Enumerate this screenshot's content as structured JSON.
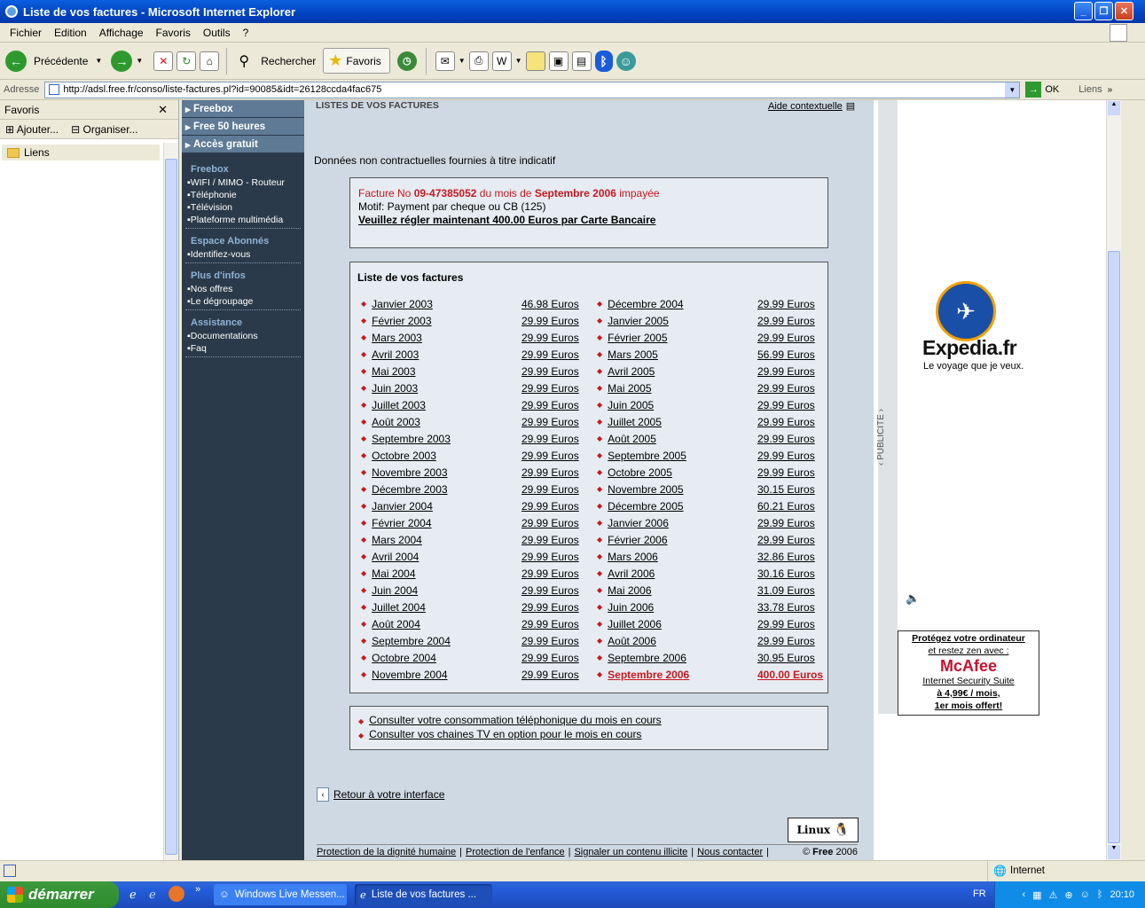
{
  "window": {
    "title": "Liste de vos factures - Microsoft Internet Explorer"
  },
  "menu": [
    "Fichier",
    "Edition",
    "Affichage",
    "Favoris",
    "Outils",
    "?"
  ],
  "toolbar": {
    "back_label": "Précédente",
    "search_label": "Rechercher",
    "favorites_label": "Favoris"
  },
  "address": {
    "label": "Adresse",
    "url": "http://adsl.free.fr/conso/liste-factures.pl?id=90085&idt=26128ccda4fac675",
    "go_label": "OK",
    "links_label": "Liens"
  },
  "favpanel": {
    "title": "Favoris",
    "add_label": "Ajouter...",
    "organize_label": "Organiser...",
    "folder": "Liens"
  },
  "leftnav": {
    "tabs": [
      "Freebox",
      "Free 50 heures",
      "Accès gratuit"
    ],
    "sections": [
      {
        "title": "Freebox",
        "items": [
          "WIFI / MIMO - Routeur",
          "Téléphonie",
          "Télévision",
          "Plateforme multimédia"
        ]
      },
      {
        "title": "Espace Abonnés",
        "items": [
          "Identifiez-vous"
        ]
      },
      {
        "title": "Plus d'infos",
        "items": [
          "Nos offres",
          "Le dégroupage"
        ]
      },
      {
        "title": "Assistance",
        "items": [
          "Documentations",
          "Faq"
        ]
      }
    ]
  },
  "main": {
    "header_title": "LISTES DE VOS FACTURES",
    "help_label": "Aide contextuelle",
    "disclaimer": "Données non contractuelles fournies à titre indicatif",
    "alert": {
      "prefix": "Facture No ",
      "number": "09-47385052",
      "mid": " du mois de ",
      "month": "Septembre 2006",
      "suffix": " impayée",
      "motif": "Motif: Payment par cheque ou CB (125)",
      "cta": "Veuillez régler maintenant 400.00 Euros par Carte Bancaire"
    },
    "list_title": "Liste de vos factures",
    "invoices_left": [
      [
        "Janvier 2003",
        "46.98 Euros"
      ],
      [
        "Février 2003",
        "29.99 Euros"
      ],
      [
        "Mars 2003",
        "29.99 Euros"
      ],
      [
        "Avril 2003",
        "29.99 Euros"
      ],
      [
        "Mai 2003",
        "29.99 Euros"
      ],
      [
        "Juin 2003",
        "29.99 Euros"
      ],
      [
        "Juillet 2003",
        "29.99 Euros"
      ],
      [
        "Août 2003",
        "29.99 Euros"
      ],
      [
        "Septembre 2003",
        "29.99 Euros"
      ],
      [
        "Octobre 2003",
        "29.99 Euros"
      ],
      [
        "Novembre 2003",
        "29.99 Euros"
      ],
      [
        "Décembre 2003",
        "29.99 Euros"
      ],
      [
        "Janvier 2004",
        "29.99 Euros"
      ],
      [
        "Février 2004",
        "29.99 Euros"
      ],
      [
        "Mars 2004",
        "29.99 Euros"
      ],
      [
        "Avril 2004",
        "29.99 Euros"
      ],
      [
        "Mai 2004",
        "29.99 Euros"
      ],
      [
        "Juin 2004",
        "29.99 Euros"
      ],
      [
        "Juillet 2004",
        "29.99 Euros"
      ],
      [
        "Août 2004",
        "29.99 Euros"
      ],
      [
        "Septembre 2004",
        "29.99 Euros"
      ],
      [
        "Octobre 2004",
        "29.99 Euros"
      ],
      [
        "Novembre 2004",
        "29.99 Euros"
      ]
    ],
    "invoices_right": [
      [
        "Décembre 2004",
        "29.99 Euros"
      ],
      [
        "Janvier 2005",
        "29.99 Euros"
      ],
      [
        "Février 2005",
        "29.99 Euros"
      ],
      [
        "Mars 2005",
        "56.99 Euros"
      ],
      [
        "Avril 2005",
        "29.99 Euros"
      ],
      [
        "Mai 2005",
        "29.99 Euros"
      ],
      [
        "Juin 2005",
        "29.99 Euros"
      ],
      [
        "Juillet 2005",
        "29.99 Euros"
      ],
      [
        "Août 2005",
        "29.99 Euros"
      ],
      [
        "Septembre 2005",
        "29.99 Euros"
      ],
      [
        "Octobre 2005",
        "29.99 Euros"
      ],
      [
        "Novembre 2005",
        "30.15 Euros"
      ],
      [
        "Décembre 2005",
        "60.21 Euros"
      ],
      [
        "Janvier 2006",
        "29.99 Euros"
      ],
      [
        "Février 2006",
        "29.99 Euros"
      ],
      [
        "Mars 2006",
        "32.86 Euros"
      ],
      [
        "Avril 2006",
        "30.16 Euros"
      ],
      [
        "Mai 2006",
        "31.09 Euros"
      ],
      [
        "Juin 2006",
        "33.78 Euros"
      ],
      [
        "Juillet 2006",
        "29.99 Euros"
      ],
      [
        "Août 2006",
        "29.99 Euros"
      ],
      [
        "Septembre 2006",
        "30.95 Euros"
      ],
      [
        "Septembre 2006",
        "400.00 Euros"
      ]
    ],
    "extra_links": [
      "Consulter votre consommation téléphonique du mois en cours",
      "Consulter vos chaines TV en option pour le mois en cours"
    ],
    "back_link": "Retour à votre interface",
    "linux_badge": "Linux",
    "footer_links": [
      "Protection de la dignité humaine",
      "Protection de l'enfance",
      "Signaler un contenu illicite",
      "Nous contacter"
    ],
    "copyright_prefix": "© ",
    "copyright_brand": "Free",
    "copyright_year": " 2006"
  },
  "ad": {
    "pub_label": "‹ PUBLICITE ›",
    "expedia_brand": "Expedia.fr",
    "expedia_tagline": "Le voyage que je veux.",
    "mcafee_line1": "Protégez votre ordinateur",
    "mcafee_line2": "et restez zen avec :",
    "mcafee_brand": "McAfee",
    "mcafee_product": "Internet Security Suite",
    "mcafee_price": "à 4,99€ / mois,",
    "mcafee_offer": "1er mois offert!"
  },
  "status": {
    "zone": "Internet"
  },
  "taskbar": {
    "start": "démarrer",
    "tasks": [
      "Windows Live Messen...",
      "Liste de vos factures ..."
    ],
    "lang": "FR",
    "time": "20:10"
  },
  "colors": {
    "alert_red": "#c8171f",
    "nav_bg": "#2b3a4a",
    "main_bg": "#ced9e3"
  }
}
